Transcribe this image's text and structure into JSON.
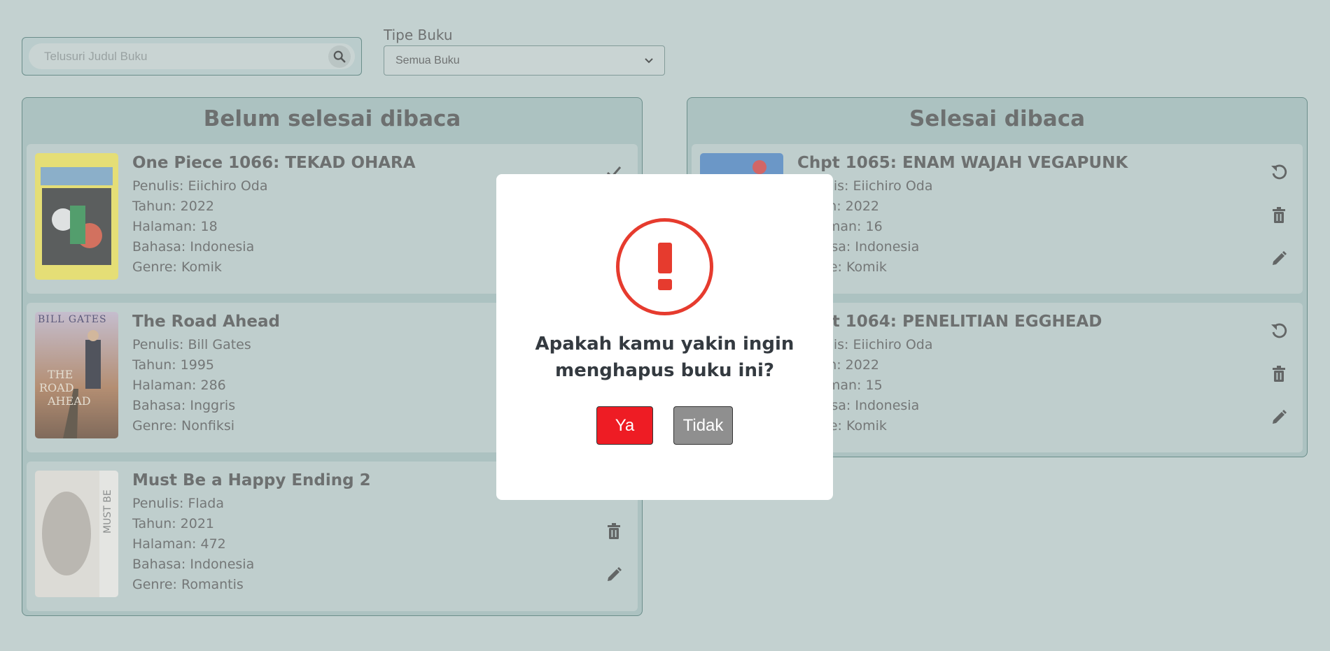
{
  "search": {
    "placeholder": "Telusuri Judul Buku"
  },
  "filter": {
    "label": "Tipe Buku",
    "selected": "Semua Buku"
  },
  "unfinished": {
    "title": "Belum selesai dibaca",
    "books": [
      {
        "title": "One Piece 1066: TEKAD OHARA",
        "author": "Penulis: Eiichiro Oda",
        "year": "Tahun: 2022",
        "pages": "Halaman: 18",
        "language": "Bahasa: Indonesia",
        "genre": "Genre: Komik"
      },
      {
        "title": "The Road Ahead",
        "author": "Penulis: Bill Gates",
        "year": "Tahun: 1995",
        "pages": "Halaman: 286",
        "language": "Bahasa: Inggris",
        "genre": "Genre: Nonfiksi",
        "cover_text": "BILL GATES"
      },
      {
        "title": "Must Be a Happy Ending 2",
        "author": "Penulis: Flada",
        "year": "Tahun: 2021",
        "pages": "Halaman: 472",
        "language": "Bahasa: Indonesia",
        "genre": "Genre: Romantis"
      }
    ]
  },
  "finished": {
    "title": "Selesai dibaca",
    "books": [
      {
        "title": "Chpt 1065: ENAM WAJAH VEGAPUNK",
        "author": "Penulis: Eiichiro Oda",
        "year": "Tahun: 2022",
        "pages": "Halaman: 16",
        "language": "Bahasa: Indonesia",
        "genre": "Genre: Komik"
      },
      {
        "title": "Chpt 1064: PENELITIAN EGGHEAD",
        "author": "Penulis: Eiichiro Oda",
        "year": "Tahun: 2022",
        "pages": "Halaman: 15",
        "language": "Bahasa: Indonesia",
        "genre": "Genre: Komik"
      }
    ]
  },
  "modal": {
    "message": "Apakah kamu yakin ingin menghapus buku ini?",
    "yes_label": "Ya",
    "no_label": "Tidak"
  },
  "colors": {
    "danger": "#e63b2e",
    "yes_button": "#ee1c24",
    "no_button": "#8f8f8f"
  }
}
